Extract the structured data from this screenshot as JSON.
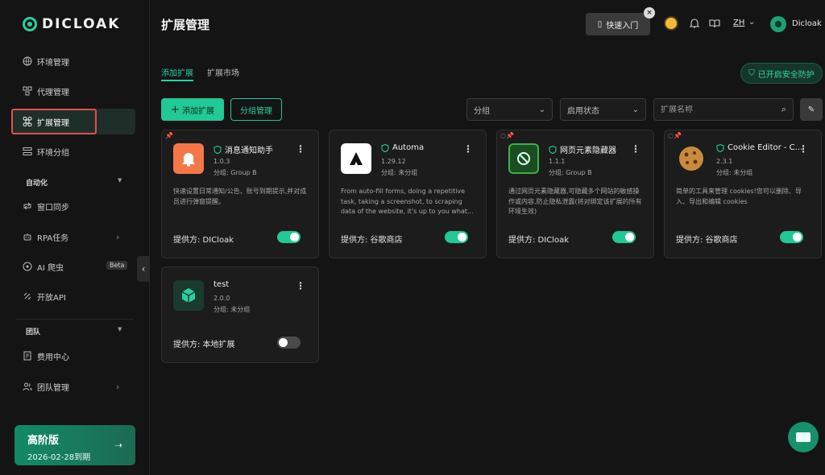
{
  "app": {
    "logo_text": "DICLOAK"
  },
  "sidebar": {
    "items": [
      {
        "label": "环境管理"
      },
      {
        "label": "代理管理"
      },
      {
        "label": "扩展管理"
      },
      {
        "label": "环境分组"
      }
    ],
    "sections": [
      {
        "label": "自动化",
        "items": [
          {
            "label": "窗口同步"
          },
          {
            "label": "RPA任务"
          },
          {
            "label": "AI 爬虫",
            "badge": "Beta"
          },
          {
            "label": "开放API"
          }
        ]
      },
      {
        "label": "团队",
        "items": [
          {
            "label": "费用中心"
          },
          {
            "label": "团队管理"
          }
        ]
      }
    ],
    "plan": {
      "name": "高阶版",
      "expiry": "2026-02-28到期"
    }
  },
  "header": {
    "title": "扩展管理",
    "quick_start": "快速入门",
    "lang": "ZH",
    "user": "Dicloak"
  },
  "tabs": [
    {
      "label": "添加扩展"
    },
    {
      "label": "扩展市场"
    }
  ],
  "security_badge": "已开启安全防护",
  "toolbar": {
    "add_label": "添加扩展",
    "group_manage_label": "分组管理",
    "group_select": "分组",
    "status_select": "启用状态",
    "search_placeholder": "扩展名称"
  },
  "extensions": [
    {
      "title": "消息通知助手",
      "version": "1.0.3",
      "group": "分组: Group B",
      "desc": "快速设置日常通知/公告、账号到期提示,并对成员进行弹窗提醒。",
      "provider": "提供方: DICloak",
      "enabled": true,
      "icon": "bell-icon",
      "color": "#f4774a"
    },
    {
      "title": "Automa",
      "version": "1.29.12",
      "group": "分组: 未分组",
      "desc": "From auto-fill forms, doing a repetitive task, taking a screenshot, to scraping data of the website, it's up to you what...",
      "provider": "提供方: 谷歌商店",
      "enabled": true,
      "icon": "automa-icon",
      "color": "#f5f5f5"
    },
    {
      "title": "网页元素隐藏器",
      "version": "1.1.1",
      "group": "分组: Group B",
      "desc": "通过网页元素隐藏器,可隐藏多个网站的敏感操作或内容,防止隐私泄露(将对绑定该扩展的所有环境生效)",
      "provider": "提供方: DICloak",
      "enabled": true,
      "icon": "hide-element-icon",
      "color": "#2f8a3e"
    },
    {
      "title": "Cookie Editor - C...",
      "version": "2.3.1",
      "group": "分组: 未分组",
      "desc": "简单的工具来管理 cookies!您可以删除、导入、导出和编辑 cookies",
      "provider": "提供方: 谷歌商店",
      "enabled": true,
      "icon": "cookie-icon",
      "color": "#c98a3e"
    },
    {
      "title": "test",
      "version": "2.0.0",
      "group": "分组: 未分组",
      "desc": "",
      "provider": "提供方: 本地扩展",
      "enabled": false,
      "icon": "cube-icon",
      "color": "#1f8f6a"
    }
  ]
}
